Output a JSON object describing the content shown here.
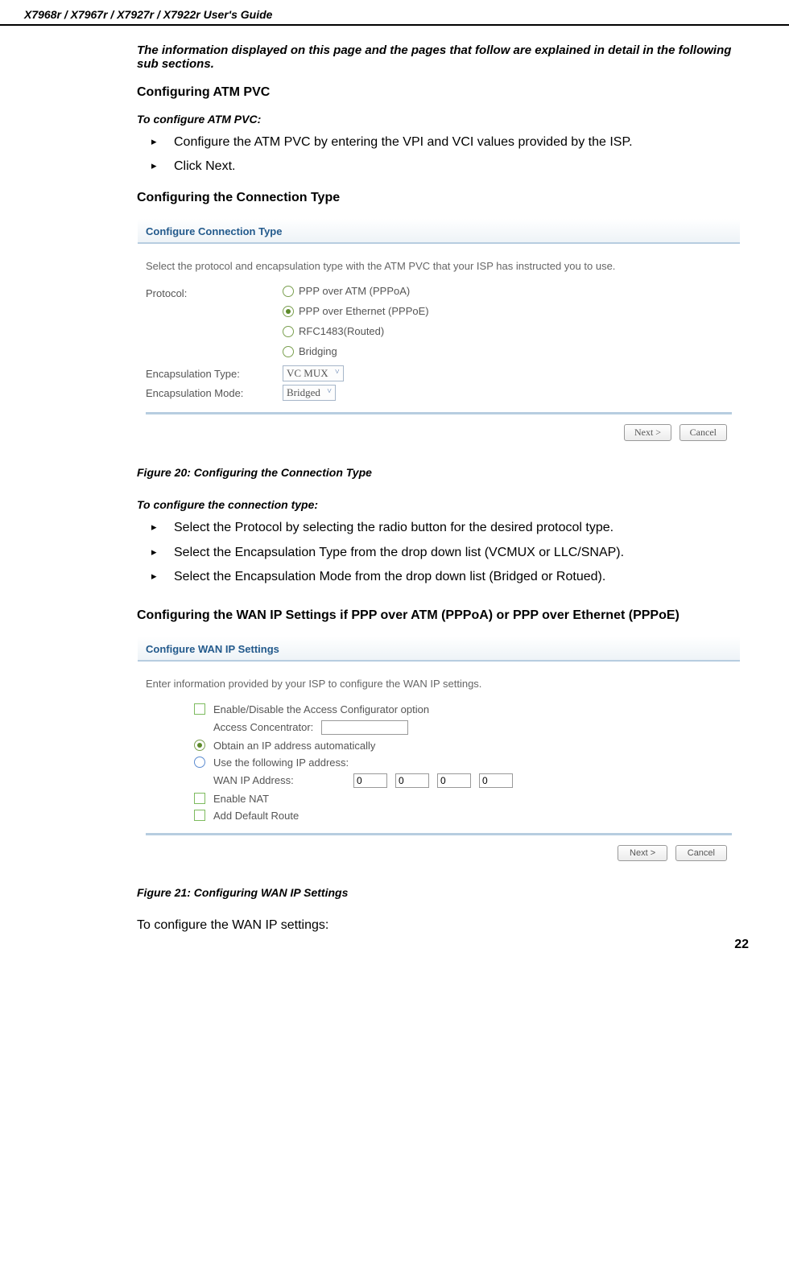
{
  "header": {
    "title": "X7968r / X7967r / X7927r / X7922r User's Guide"
  },
  "intro_italic": "The information displayed on this page and the pages that follow are explained in detail in the following sub sections.",
  "atm": {
    "heading": "Configuring ATM PVC",
    "sub": "To configure ATM PVC:",
    "items": [
      "Configure the ATM PVC by entering the VPI and VCI values provided by the ISP.",
      "Click Next."
    ]
  },
  "conn": {
    "heading": "Configuring the Connection Type",
    "shot": {
      "title": "Configure Connection Type",
      "desc": "Select the protocol and encapsulation type with the ATM PVC that your ISP has instructed you to use.",
      "protocol_label": "Protocol:",
      "opts": [
        "PPP over ATM (PPPoA)",
        "PPP over Ethernet (PPPoE)",
        "RFC1483(Routed)",
        "Bridging"
      ],
      "encap_type_label": "Encapsulation Type:",
      "encap_type_value": "VC MUX",
      "encap_mode_label": "Encapsulation Mode:",
      "encap_mode_value": "Bridged",
      "next": "Next >",
      "cancel": "Cancel"
    },
    "caption": "Figure 20: Configuring the Connection Type",
    "sub": "To configure the connection type:",
    "items": [
      "Select the Protocol by selecting the radio button for the desired protocol type.",
      "Select the Encapsulation Type from the drop down list (VCMUX or LLC/SNAP).",
      "Select the Encapsulation Mode from the drop down list (Bridged or Rotued)."
    ]
  },
  "wan": {
    "heading": "Configuring the WAN IP Settings if PPP over ATM (PPPoA) or PPP over Ethernet (PPPoE)",
    "shot": {
      "title": "Configure WAN IP Settings",
      "desc": "Enter information provided by your ISP to configure the WAN IP settings.",
      "chk_access": "Enable/Disable the Access Configurator option",
      "ac_label": "Access Concentrator:",
      "radio_auto": "Obtain an IP address automatically",
      "radio_static": "Use the following IP address:",
      "wan_ip_label": "WAN IP Address:",
      "ip": [
        "0",
        "0",
        "0",
        "0"
      ],
      "chk_nat": "Enable NAT",
      "chk_route": "Add Default Route",
      "next": "Next >",
      "cancel": "Cancel"
    },
    "caption": "Figure 21: Configuring WAN IP Settings",
    "closing": "To configure the WAN IP settings:"
  },
  "page_number": "22"
}
